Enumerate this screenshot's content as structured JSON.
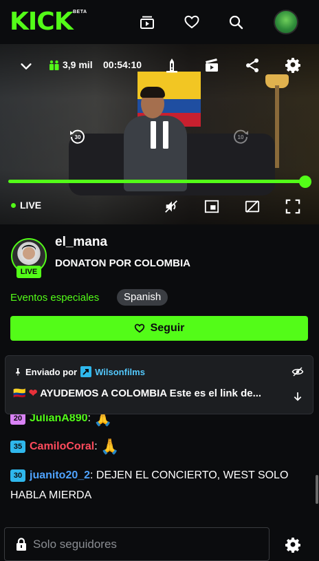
{
  "header": {
    "logo": "KICK",
    "beta": "BETA",
    "colors": {
      "brand": "#53fc18",
      "background": "#0b0c0e"
    },
    "icons": [
      "clips-icon",
      "heart-icon",
      "search-icon",
      "avatar"
    ]
  },
  "player": {
    "viewers": "3,9 mil",
    "elapsed": "00:54:10",
    "live_label": "LIVE",
    "progress": 1.0
  },
  "channel": {
    "name": "el_mana",
    "live_badge": "LIVE",
    "title": "DONATON POR COLOMBIA",
    "category": "Eventos especiales",
    "language": "Spanish",
    "follow_label": "Seguir"
  },
  "pinned": {
    "sent_by": "Enviado por",
    "user": "Wilsonfilms",
    "message": "AYUDEMOS A COLOMBIA Este es el link de..."
  },
  "chat": [
    {
      "badge": "20",
      "user": "JulianA890",
      "sep": ":",
      "text": ""
    },
    {
      "badge": "35",
      "user": "CamiloCoral",
      "sep": ":",
      "text": ""
    },
    {
      "badge": "30",
      "user": "juanito20_2",
      "sep": ":",
      "text": " DEJEN EL CONCIERTO, WEST SOLO HABLA MIERDA"
    }
  ],
  "chat_input": {
    "placeholder": "Solo seguidores"
  }
}
